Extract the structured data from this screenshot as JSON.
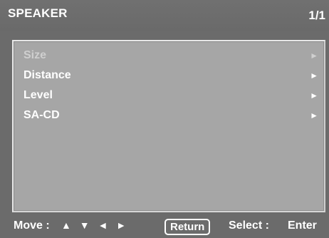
{
  "header": {
    "title": "SPEAKER",
    "page_indicator": "1/1"
  },
  "menu": {
    "items": [
      {
        "label": "Size",
        "arrow": "►",
        "enabled": false
      },
      {
        "label": "Distance",
        "arrow": "►",
        "enabled": true
      },
      {
        "label": "Level",
        "arrow": "►",
        "enabled": true
      },
      {
        "label": "SA-CD",
        "arrow": "►",
        "enabled": true
      }
    ]
  },
  "footer": {
    "move_label": "Move :",
    "move_arrows": [
      "▲",
      "▼",
      "◄",
      "►"
    ],
    "return_label": "Return",
    "select_label": "Select :",
    "enter_label": "Enter"
  },
  "colors": {
    "background": "#6b6b6b",
    "panel": "#a6a6a6",
    "text": "#ffffff",
    "disabled_text": "#cfcfcf"
  }
}
